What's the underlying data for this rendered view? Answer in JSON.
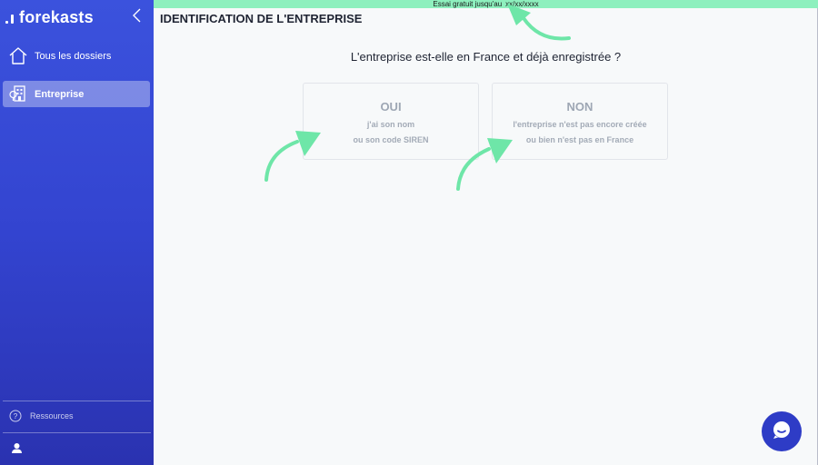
{
  "app": {
    "brand": "forekasts"
  },
  "sidebar": {
    "items": [
      {
        "label": "Tous les dossiers",
        "icon": "home-icon",
        "active": false
      },
      {
        "label": "Entreprise",
        "icon": "company-icon",
        "active": true
      }
    ],
    "resources_label": "Ressources",
    "resources_icon": "help-circle-icon",
    "user_icon": "user-icon",
    "collapse_icon": "chevron-left-icon"
  },
  "trial": {
    "label": "Essai gratuit jusqu'au",
    "date": "xx/xx/xxxx"
  },
  "main": {
    "title": "IDENTIFICATION DE L'ENTREPRISE",
    "question": "L'entreprise est-elle en France et déjà enregistrée ?",
    "choices": [
      {
        "title": "OUI",
        "line1": "j'ai son nom",
        "line2": "ou son code SIREN"
      },
      {
        "title": "NON",
        "line1": "l'entreprise n'est pas encore créée",
        "line2": "ou bien n'est pas en France"
      }
    ]
  },
  "chat": {
    "icon": "chat-bubble-icon"
  },
  "colors": {
    "sidebar": "#3b52dd",
    "trial_bar": "#8ef0be",
    "arrow": "#6ee6a8",
    "chat_button": "#2e3cc6",
    "background": "#f7f9fa"
  }
}
